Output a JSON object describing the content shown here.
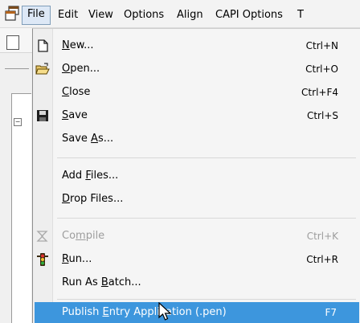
{
  "menubar": {
    "items": [
      {
        "label": "File"
      },
      {
        "label": "Edit"
      },
      {
        "label": "View"
      },
      {
        "label": "Options"
      },
      {
        "label": "Align"
      },
      {
        "label": "CAPI Options"
      },
      {
        "label": "T"
      }
    ]
  },
  "file_menu": {
    "items": [
      {
        "label_pre": "",
        "mnemonic": "N",
        "label_post": "ew...",
        "shortcut": "Ctrl+N",
        "icon": "new-document-icon"
      },
      {
        "label_pre": "",
        "mnemonic": "O",
        "label_post": "pen...",
        "shortcut": "Ctrl+O",
        "icon": "open-folder-icon"
      },
      {
        "label_pre": "",
        "mnemonic": "C",
        "label_post": "lose",
        "shortcut": "Ctrl+F4"
      },
      {
        "label_pre": "",
        "mnemonic": "S",
        "label_post": "ave",
        "shortcut": "Ctrl+S",
        "icon": "save-disk-icon"
      },
      {
        "label_pre": "Save ",
        "mnemonic": "A",
        "label_post": "s..."
      },
      {
        "label_pre": "Add ",
        "mnemonic": "F",
        "label_post": "iles..."
      },
      {
        "label_pre": "",
        "mnemonic": "D",
        "label_post": "rop Files..."
      },
      {
        "label_pre": "Co",
        "mnemonic": "m",
        "label_post": "pile",
        "shortcut": "Ctrl+K",
        "icon": "compile-icon",
        "disabled": true
      },
      {
        "label_pre": "",
        "mnemonic": "R",
        "label_post": "un...",
        "shortcut": "Ctrl+R",
        "icon": "run-traffic-light-icon"
      },
      {
        "label_pre": "Run As ",
        "mnemonic": "B",
        "label_post": "atch..."
      },
      {
        "label_pre": "Publish ",
        "mnemonic": "E",
        "label_post": "ntry Application (.pen)",
        "shortcut": "F7",
        "highlighted": true
      }
    ]
  },
  "colors": {
    "highlight": "#3d96dd",
    "menu_bg": "#f5f5f5",
    "disabled_text": "#9d9d9d"
  }
}
